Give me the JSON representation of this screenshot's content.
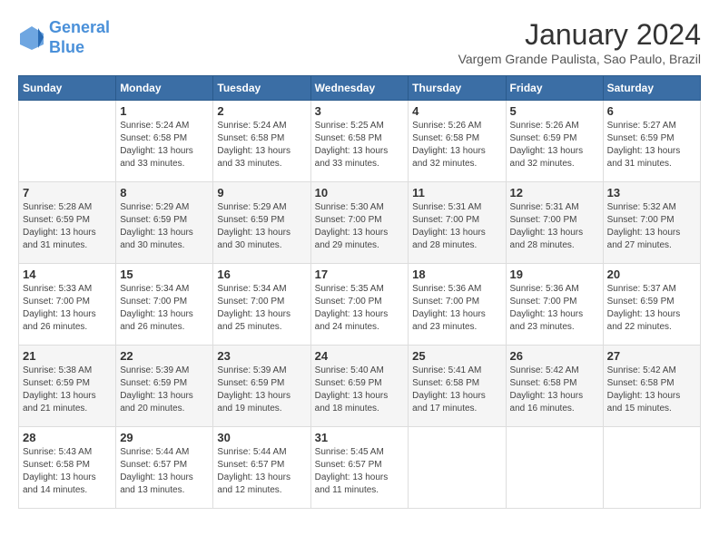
{
  "header": {
    "logo_line1": "General",
    "logo_line2": "Blue",
    "month_title": "January 2024",
    "location": "Vargem Grande Paulista, Sao Paulo, Brazil"
  },
  "weekdays": [
    "Sunday",
    "Monday",
    "Tuesday",
    "Wednesday",
    "Thursday",
    "Friday",
    "Saturday"
  ],
  "weeks": [
    [
      {
        "day": "",
        "info": ""
      },
      {
        "day": "1",
        "info": "Sunrise: 5:24 AM\nSunset: 6:58 PM\nDaylight: 13 hours\nand 33 minutes."
      },
      {
        "day": "2",
        "info": "Sunrise: 5:24 AM\nSunset: 6:58 PM\nDaylight: 13 hours\nand 33 minutes."
      },
      {
        "day": "3",
        "info": "Sunrise: 5:25 AM\nSunset: 6:58 PM\nDaylight: 13 hours\nand 33 minutes."
      },
      {
        "day": "4",
        "info": "Sunrise: 5:26 AM\nSunset: 6:58 PM\nDaylight: 13 hours\nand 32 minutes."
      },
      {
        "day": "5",
        "info": "Sunrise: 5:26 AM\nSunset: 6:59 PM\nDaylight: 13 hours\nand 32 minutes."
      },
      {
        "day": "6",
        "info": "Sunrise: 5:27 AM\nSunset: 6:59 PM\nDaylight: 13 hours\nand 31 minutes."
      }
    ],
    [
      {
        "day": "7",
        "info": "Sunrise: 5:28 AM\nSunset: 6:59 PM\nDaylight: 13 hours\nand 31 minutes."
      },
      {
        "day": "8",
        "info": "Sunrise: 5:29 AM\nSunset: 6:59 PM\nDaylight: 13 hours\nand 30 minutes."
      },
      {
        "day": "9",
        "info": "Sunrise: 5:29 AM\nSunset: 6:59 PM\nDaylight: 13 hours\nand 30 minutes."
      },
      {
        "day": "10",
        "info": "Sunrise: 5:30 AM\nSunset: 7:00 PM\nDaylight: 13 hours\nand 29 minutes."
      },
      {
        "day": "11",
        "info": "Sunrise: 5:31 AM\nSunset: 7:00 PM\nDaylight: 13 hours\nand 28 minutes."
      },
      {
        "day": "12",
        "info": "Sunrise: 5:31 AM\nSunset: 7:00 PM\nDaylight: 13 hours\nand 28 minutes."
      },
      {
        "day": "13",
        "info": "Sunrise: 5:32 AM\nSunset: 7:00 PM\nDaylight: 13 hours\nand 27 minutes."
      }
    ],
    [
      {
        "day": "14",
        "info": "Sunrise: 5:33 AM\nSunset: 7:00 PM\nDaylight: 13 hours\nand 26 minutes."
      },
      {
        "day": "15",
        "info": "Sunrise: 5:34 AM\nSunset: 7:00 PM\nDaylight: 13 hours\nand 26 minutes."
      },
      {
        "day": "16",
        "info": "Sunrise: 5:34 AM\nSunset: 7:00 PM\nDaylight: 13 hours\nand 25 minutes."
      },
      {
        "day": "17",
        "info": "Sunrise: 5:35 AM\nSunset: 7:00 PM\nDaylight: 13 hours\nand 24 minutes."
      },
      {
        "day": "18",
        "info": "Sunrise: 5:36 AM\nSunset: 7:00 PM\nDaylight: 13 hours\nand 23 minutes."
      },
      {
        "day": "19",
        "info": "Sunrise: 5:36 AM\nSunset: 7:00 PM\nDaylight: 13 hours\nand 23 minutes."
      },
      {
        "day": "20",
        "info": "Sunrise: 5:37 AM\nSunset: 6:59 PM\nDaylight: 13 hours\nand 22 minutes."
      }
    ],
    [
      {
        "day": "21",
        "info": "Sunrise: 5:38 AM\nSunset: 6:59 PM\nDaylight: 13 hours\nand 21 minutes."
      },
      {
        "day": "22",
        "info": "Sunrise: 5:39 AM\nSunset: 6:59 PM\nDaylight: 13 hours\nand 20 minutes."
      },
      {
        "day": "23",
        "info": "Sunrise: 5:39 AM\nSunset: 6:59 PM\nDaylight: 13 hours\nand 19 minutes."
      },
      {
        "day": "24",
        "info": "Sunrise: 5:40 AM\nSunset: 6:59 PM\nDaylight: 13 hours\nand 18 minutes."
      },
      {
        "day": "25",
        "info": "Sunrise: 5:41 AM\nSunset: 6:58 PM\nDaylight: 13 hours\nand 17 minutes."
      },
      {
        "day": "26",
        "info": "Sunrise: 5:42 AM\nSunset: 6:58 PM\nDaylight: 13 hours\nand 16 minutes."
      },
      {
        "day": "27",
        "info": "Sunrise: 5:42 AM\nSunset: 6:58 PM\nDaylight: 13 hours\nand 15 minutes."
      }
    ],
    [
      {
        "day": "28",
        "info": "Sunrise: 5:43 AM\nSunset: 6:58 PM\nDaylight: 13 hours\nand 14 minutes."
      },
      {
        "day": "29",
        "info": "Sunrise: 5:44 AM\nSunset: 6:57 PM\nDaylight: 13 hours\nand 13 minutes."
      },
      {
        "day": "30",
        "info": "Sunrise: 5:44 AM\nSunset: 6:57 PM\nDaylight: 13 hours\nand 12 minutes."
      },
      {
        "day": "31",
        "info": "Sunrise: 5:45 AM\nSunset: 6:57 PM\nDaylight: 13 hours\nand 11 minutes."
      },
      {
        "day": "",
        "info": ""
      },
      {
        "day": "",
        "info": ""
      },
      {
        "day": "",
        "info": ""
      }
    ]
  ]
}
